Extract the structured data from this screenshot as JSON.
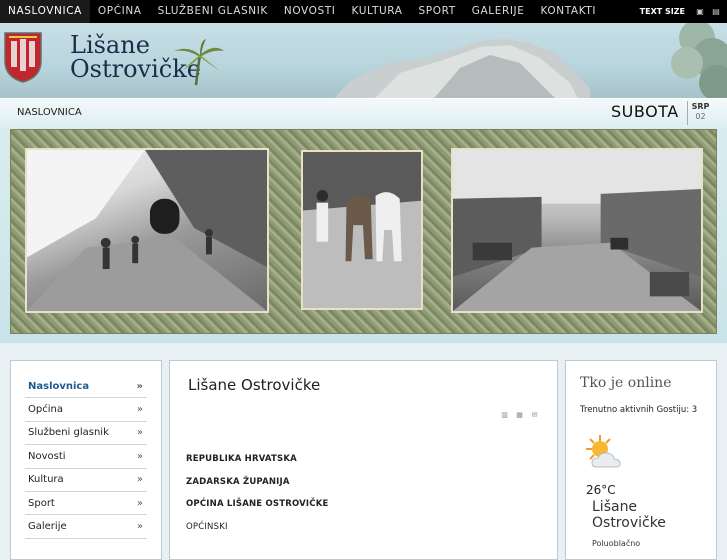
{
  "topnav": {
    "items": [
      "NASLOVNICA",
      "OPĆINA",
      "SLUŽBENI GLASNIK",
      "NOVOSTI",
      "KULTURA",
      "SPORT",
      "GALERIJE",
      "KONTAKTI"
    ],
    "text_size_label": "TEXT SIZE"
  },
  "header": {
    "logo_line1": "Lišane",
    "logo_line2": "Ostrovičke"
  },
  "banner": {
    "breadcrumb": "NASLOVNICA",
    "day": "SUBOTA",
    "month": "SRP",
    "date": "02"
  },
  "menu": {
    "items": [
      "Naslovnica",
      "Općina",
      "Službeni glasnik",
      "Novosti",
      "Kultura",
      "Sport",
      "Galerije"
    ],
    "arrow": "»"
  },
  "main": {
    "title": "Lišane Ostrovičke",
    "lines": [
      "REPUBLIKA HRVATSKA",
      "ZADARSKA ŽUPANIJA",
      "OPĆINA LIŠANE OSTROVIČKE",
      "OPĆINSKI"
    ]
  },
  "right": {
    "title": "Tko je online",
    "online_text": "Trenutno aktivnih Gostiju: 3",
    "temperature": "26°C",
    "town_line1": "Lišane",
    "town_line2": "Ostrovičke",
    "condition": "Poluoblačno"
  },
  "colors": {
    "nav_bg": "#000000",
    "menu_active": "#1e5b8f",
    "logo_text": "#1a2e4a",
    "shield_red": "#c0272d"
  }
}
